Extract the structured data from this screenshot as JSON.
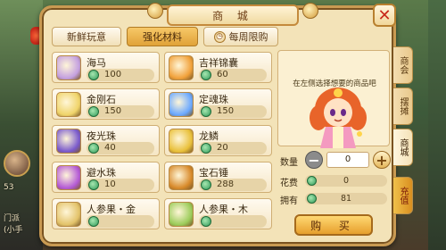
{
  "window": {
    "title": "商 城",
    "close_label": "✕"
  },
  "tabs": [
    {
      "label": "新鲜玩意",
      "active": false
    },
    {
      "label": "强化材料",
      "active": true
    },
    {
      "label": "每周限购",
      "active": false,
      "icon": "alarm-clock-icon"
    }
  ],
  "items": [
    {
      "name": "海马",
      "price": "100",
      "icon": "seahorse-icon",
      "color": "#c4a0e0"
    },
    {
      "name": "吉祥锦囊",
      "price": "60",
      "icon": "lucky-bag-icon",
      "color": "#f1a13a"
    },
    {
      "name": "金刚石",
      "price": "150",
      "icon": "diamond-stone-icon",
      "color": "#f0d46a"
    },
    {
      "name": "定魂珠",
      "price": "150",
      "icon": "soul-pearl-icon",
      "color": "#6aa8ff"
    },
    {
      "name": "夜光珠",
      "price": "40",
      "icon": "night-pearl-icon",
      "color": "#7a5acc"
    },
    {
      "name": "龙鳞",
      "price": "20",
      "icon": "dragon-scale-icon",
      "color": "#e9c03a"
    },
    {
      "name": "避水珠",
      "price": "10",
      "icon": "water-pearl-icon",
      "color": "#b45ad6"
    },
    {
      "name": "宝石锤",
      "price": "288",
      "icon": "gem-hammer-icon",
      "color": "#d88a2a"
    },
    {
      "name": "人参果・金",
      "price": "",
      "icon": "ginseng-fruit-gold-icon",
      "color": "#e3c36a"
    },
    {
      "name": "人参果・木",
      "price": "",
      "icon": "ginseng-fruit-wood-icon",
      "color": "#9ccc5a"
    }
  ],
  "info": {
    "hint": "在左侧选择想要的商品吧"
  },
  "purchase": {
    "quantity_label": "数量",
    "quantity": "0",
    "minus": "−",
    "plus": "+",
    "cost_label": "花费",
    "cost": "0",
    "owned_label": "拥有",
    "owned": "81",
    "buy_label": "购 买"
  },
  "side_tabs": [
    {
      "label": "商会",
      "active": false
    },
    {
      "label": "摆摊",
      "active": false
    },
    {
      "label": "商城",
      "active": true
    },
    {
      "label": "充值",
      "active": false,
      "highlight": true
    }
  ],
  "background": {
    "left_texts": [
      "53",
      "门派",
      "(小手"
    ]
  },
  "colors": {
    "accent": "#e0a238",
    "currency": "#2f9a58",
    "close": "#c8281a"
  }
}
